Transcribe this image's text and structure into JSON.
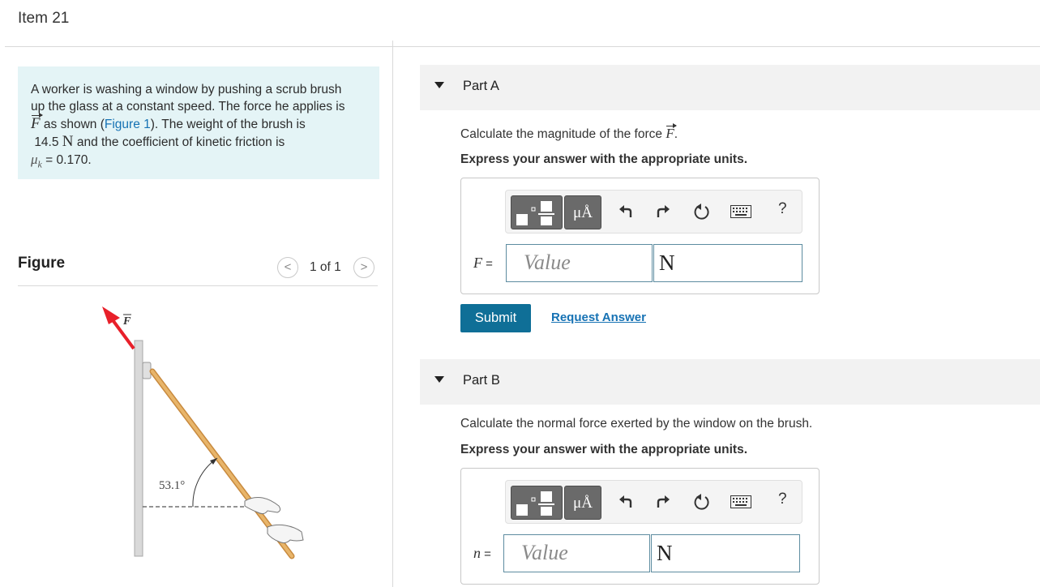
{
  "header": {
    "item_title": "Item 21"
  },
  "problem": {
    "line1": "A worker is washing a window by pushing a scrub brush",
    "line2": "up the glass at a constant speed. The force he applies is",
    "force_symbol": "F",
    "line3_a": " as shown (",
    "figure_link": "Figure 1",
    "line3_b": "). The weight of the brush is",
    "weight_value": "14.5",
    "weight_unit": "N",
    "line4_tail": " and the coefficient of kinetic friction is",
    "mu_symbol": "μ",
    "mu_sub": "k",
    "mu_value": " = 0.170."
  },
  "figure": {
    "label": "Figure",
    "pager_prev": "<",
    "pager_count": "1 of 1",
    "pager_next": ">",
    "force_label": "F",
    "angle_label": "53.1°",
    "colors": {
      "force_arrow": "#e8202a",
      "handle": "#e8b56a",
      "wall": "#d9d9d9"
    }
  },
  "partA": {
    "title": "Part A",
    "question_text": "Calculate the magnitude of the force ",
    "question_symbol": "F",
    "question_end": ".",
    "instruction": "Express your answer with the appropriate units.",
    "toolbar": {
      "units_button": "μÅ",
      "help": "?",
      "icons": [
        "template-icon",
        "undo-icon",
        "redo-icon",
        "reset-icon",
        "keyboard-icon"
      ]
    },
    "var_label": "F",
    "var_eq": " =",
    "value_placeholder": "Value",
    "unit_value": "N",
    "submit_label": "Submit",
    "request_label": "Request Answer"
  },
  "partB": {
    "title": "Part B",
    "question_text": "Calculate the normal force exerted by the window on the brush.",
    "instruction": "Express your answer with the appropriate units.",
    "toolbar": {
      "units_button": "μÅ",
      "help": "?"
    },
    "var_label": "n",
    "var_eq": " =",
    "value_placeholder": "Value",
    "unit_value": "N"
  },
  "colors": {
    "accent": "#0f6f97",
    "link": "#1672b4",
    "problem_bg": "#e4f4f6",
    "part_header_bg": "#f2f2f2"
  }
}
